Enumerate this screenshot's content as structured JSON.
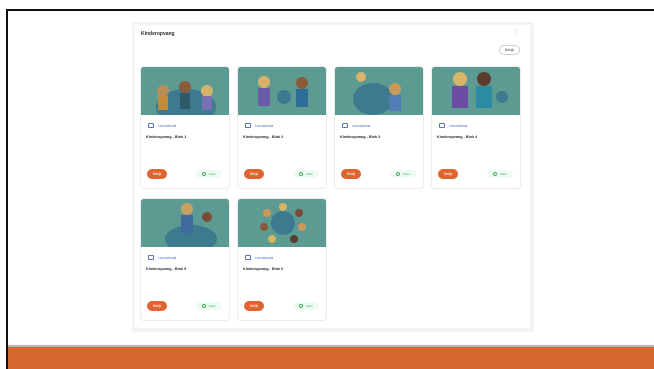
{
  "panel": {
    "title": "Kinderopvang",
    "top_button": "Bekijk",
    "kebab": "⋮"
  },
  "cards": [
    {
      "type_label": "Lesmateriaal",
      "title": "Kinderopvang - Blok 1",
      "open_label": "Bekijk",
      "share_label": "Delen"
    },
    {
      "type_label": "Lesmateriaal",
      "title": "Kinderopvang - Blok 2",
      "open_label": "Bekijk",
      "share_label": "Delen"
    },
    {
      "type_label": "Lesmateriaal",
      "title": "Kinderopvang - Blok 3",
      "open_label": "Bekijk",
      "share_label": "Delen"
    },
    {
      "type_label": "Lesmateriaal",
      "title": "Kinderopvang - Blok 4",
      "open_label": "Bekijk",
      "share_label": "Delen"
    },
    {
      "type_label": "Lesmateriaal",
      "title": "Kinderopvang - Blok 5",
      "open_label": "Bekijk",
      "share_label": "Delen"
    },
    {
      "type_label": "Lesmateriaal",
      "title": "Kinderopvang - Blok 6",
      "open_label": "Bekijk",
      "share_label": "Delen"
    }
  ],
  "colors": {
    "accent": "#e0642f",
    "footer": "#d6692d",
    "link": "#5b6fd1",
    "share": "#41b36a",
    "image_overlay": "#5c9a92"
  }
}
